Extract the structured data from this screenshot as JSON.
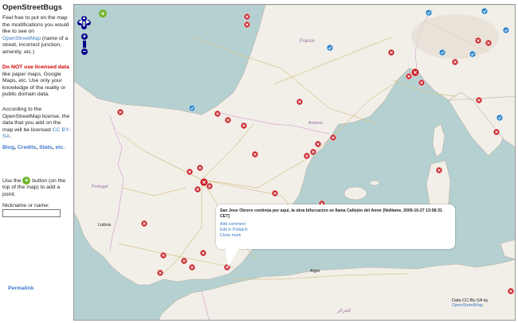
{
  "sidebar": {
    "title": "OpenStreetBugs",
    "intro_before": "Feel free to put on the map the modifications you would like to see on ",
    "intro_link": "OpenStreetMap",
    "intro_after": " (name of a street, incorrect junction, amenity, etc.)",
    "warn_bold": "Do NOT use licensed data",
    "warn_rest": " like paper maps, Google Maps, etc. Use only your knowledge of the reality or public domain data.",
    "license_text": "According to the OpenStreetMap license, the data that you add on the map will be licensed ",
    "license_link": "CC BY-SA",
    "license_end": ".",
    "blog_link": "Blog",
    "credits_link": "Credits",
    "stats_link": "Stats",
    "etc": "etc.",
    "add_before": "Use the ",
    "add_after": " button (on the top of the map) to add a point.",
    "nickname_label": "Nickname or name:",
    "nickname_value": "",
    "permalink": "Permalink"
  },
  "popup": {
    "description": "San Jose Obrero continúa por aquí, la obra bifurcacion se llama Callejón del Amor [NoName, 2009-10-27 13:08:31 CET]",
    "add_comment": "Add comment",
    "edit_potlatch": "Edit in Potlatch",
    "close_mark": "Close mark"
  },
  "map_labels": {
    "france": "France",
    "andorra": "Andorra",
    "portugal": "Portugal",
    "lisboa": "Lisboa",
    "alger": "Alger",
    "algeria": "الجزائر"
  },
  "attribution": {
    "prefix": "Data CC-By-SA by ",
    "link": "OpenStreetMap"
  },
  "controls": {
    "pan_up": "▲",
    "pan_left": "◀",
    "pan_right": "▶",
    "pan_down": "▼",
    "zoom_in": "+",
    "zoom_out": "−",
    "add_bug": "+"
  },
  "icons": {
    "open_bug": "red-x-circle-icon",
    "closed_bug": "blue-check-circle-icon",
    "add_bug": "green-plus-icon"
  },
  "colors": {
    "sea": "#b5d0d0",
    "land": "#f2efe9",
    "open_bug": "#c8252b",
    "closed_bug": "#2f86c9",
    "link": "#3d79c6",
    "warning": "#d40000"
  }
}
